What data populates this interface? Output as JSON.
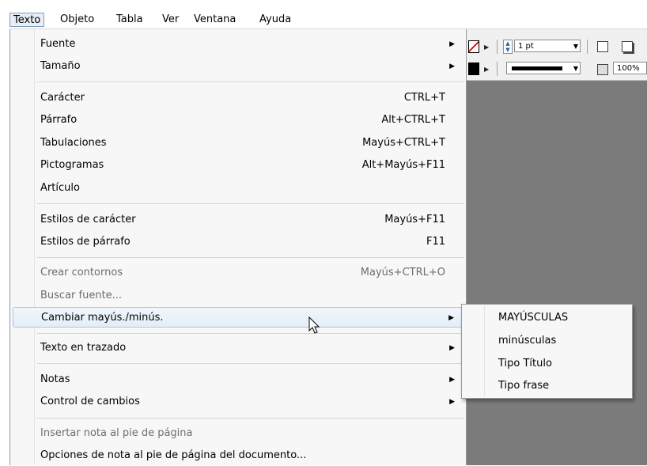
{
  "menubar": {
    "items": [
      "Texto",
      "Objeto",
      "Tabla",
      "Ver",
      "Ventana",
      "Ayuda"
    ]
  },
  "toolbar": {
    "stroke_weight": "1 pt",
    "zoom": "100%"
  },
  "menu": {
    "items": [
      {
        "label": "Fuente",
        "shortcut": "",
        "submenu": true
      },
      {
        "label": "Tamaño",
        "shortcut": "",
        "submenu": true
      },
      {
        "label": "Carácter",
        "shortcut": "CTRL+T"
      },
      {
        "label": "Párrafo",
        "shortcut": "Alt+CTRL+T"
      },
      {
        "label": "Tabulaciones",
        "shortcut": "Mayús+CTRL+T"
      },
      {
        "label": "Pictogramas",
        "shortcut": "Alt+Mayús+F11"
      },
      {
        "label": "Artículo",
        "shortcut": ""
      },
      {
        "label": "Estilos de carácter",
        "shortcut": "Mayús+F11"
      },
      {
        "label": "Estilos de párrafo",
        "shortcut": "F11"
      },
      {
        "label": "Crear contornos",
        "shortcut": "Mayús+CTRL+O",
        "disabled": true
      },
      {
        "label": "Buscar fuente...",
        "shortcut": "",
        "disabled": true
      },
      {
        "label": "Cambiar mayús./minús.",
        "shortcut": "",
        "submenu": true,
        "highlighted": true
      },
      {
        "label": "Texto en trazado",
        "shortcut": "",
        "submenu": true
      },
      {
        "label": "Notas",
        "shortcut": "",
        "submenu": true
      },
      {
        "label": "Control de cambios",
        "shortcut": "",
        "submenu": true
      },
      {
        "label": "Insertar nota al pie de página",
        "shortcut": "",
        "disabled": true
      },
      {
        "label": "Opciones de nota al pie de página del documento...",
        "shortcut": ""
      }
    ]
  },
  "submenu": {
    "items": [
      "MAYÚSCULAS",
      "minúsculas",
      "Tipo Título",
      "Tipo frase"
    ]
  },
  "colors": {
    "canvas": "#7b7b7b",
    "menu_bg": "#f7f7f7",
    "highlight_border": "#a9c4e6"
  }
}
